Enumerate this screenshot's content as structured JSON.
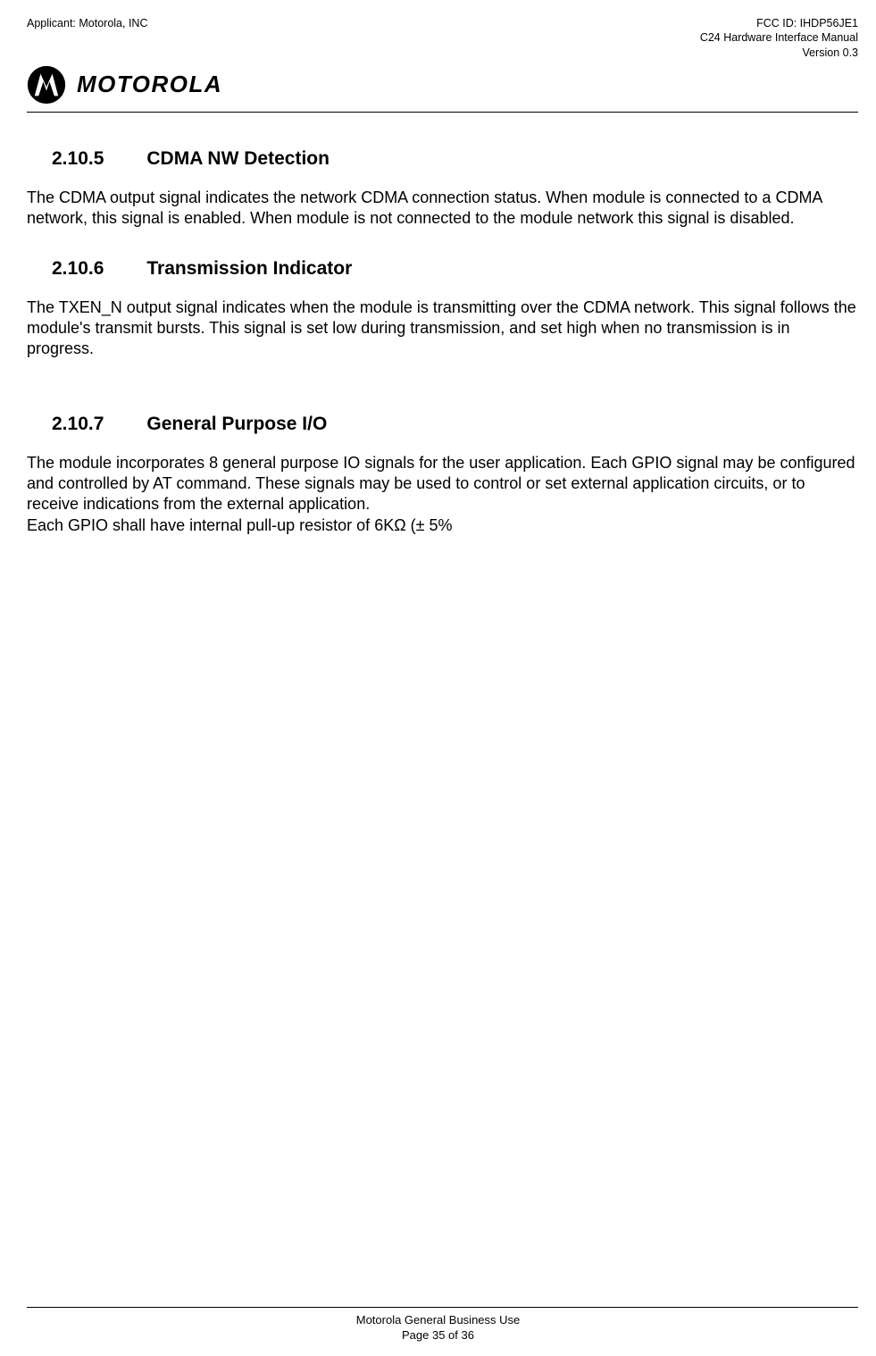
{
  "header": {
    "applicant": "Applicant: Motorola, INC",
    "fcc_id": "FCC ID: IHDP56JE1",
    "manual_title": "C24 Hardware Interface Manual",
    "version": "Version 0.3",
    "logo_text": "MOTOROLA"
  },
  "sections": [
    {
      "number": "2.10.5",
      "title": "CDMA NW Detection",
      "body": "The CDMA output signal indicates the network CDMA connection status. When module is connected to a CDMA network, this signal is enabled. When module is not connected to the module network this signal is disabled."
    },
    {
      "number": "2.10.6",
      "title": "Transmission Indicator",
      "body": "The TXEN_N output signal indicates when the module is transmitting over the CDMA network. This signal follows the module's transmit bursts. This signal is set low during transmission, and set high when no transmission is in progress."
    },
    {
      "number": "2.10.7",
      "title": "General Purpose I/O",
      "body": "The module incorporates 8 general purpose IO signals for the user application. Each GPIO signal may be configured and controlled by AT command. These signals may be used to control or set external application circuits, or to receive indications from the external application.\nEach GPIO shall have internal pull-up resistor of 6KΩ (± 5%"
    }
  ],
  "footer": {
    "line1": "Motorola General Business Use",
    "line2": "Page 35 of 36"
  }
}
